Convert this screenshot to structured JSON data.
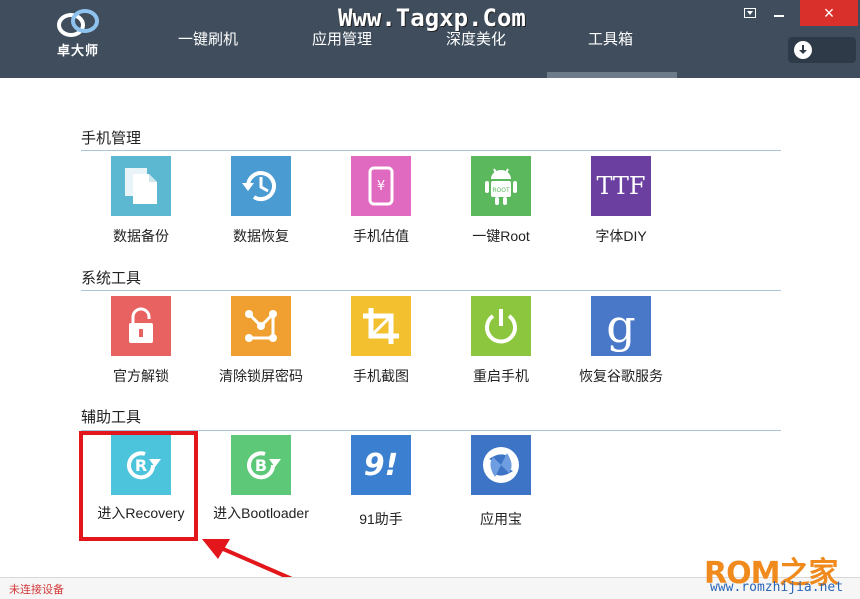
{
  "app": {
    "logo_text": "卓大师",
    "watermark": "Www.Tagxp.Com"
  },
  "nav": {
    "items": [
      {
        "label": "一键刷机"
      },
      {
        "label": "应用管理"
      },
      {
        "label": "深度美化"
      },
      {
        "label": "工具箱",
        "active": true
      }
    ]
  },
  "window_controls": {
    "close": "×"
  },
  "sections": [
    {
      "title": "手机管理",
      "tiles": [
        {
          "label": "数据备份",
          "icon": "documents-icon",
          "color": "#5bb8d0"
        },
        {
          "label": "数据恢复",
          "icon": "history-clock-icon",
          "color": "#4a9bd2"
        },
        {
          "label": "手机估值",
          "icon": "phone-yuan-icon",
          "color": "#e06ac0"
        },
        {
          "label": "一键Root",
          "icon": "android-root-icon",
          "color": "#5cb85c"
        },
        {
          "label": "字体DIY",
          "icon": "ttf-font-icon",
          "color": "#6b3fa0",
          "icon_text": "TTF"
        }
      ]
    },
    {
      "title": "系统工具",
      "tiles": [
        {
          "label": "官方解锁",
          "icon": "padlock-icon",
          "color": "#e96262"
        },
        {
          "label": "清除锁屏密码",
          "icon": "pattern-lock-icon",
          "color": "#f0a030"
        },
        {
          "label": "手机截图",
          "icon": "crop-icon",
          "color": "#f3c030"
        },
        {
          "label": "重启手机",
          "icon": "power-icon",
          "color": "#8cc63e"
        },
        {
          "label": "恢复谷歌服务",
          "icon": "google-g-icon",
          "color": "#4a78c9",
          "icon_text": "g"
        }
      ]
    },
    {
      "title": "辅助工具",
      "tiles": [
        {
          "label": "进入Recovery",
          "icon": "recovery-r-icon",
          "color": "#4cc4dc",
          "icon_text": "R"
        },
        {
          "label": "进入Bootloader",
          "icon": "bootloader-b-icon",
          "color": "#5cc878",
          "icon_text": "B"
        },
        {
          "label": "91助手",
          "icon": "ninety-one-icon",
          "color": "#3a7fd0",
          "icon_text": "9!"
        },
        {
          "label": "应用宝",
          "icon": "yingyongbao-icon",
          "color": "#3e74c5"
        }
      ]
    }
  ],
  "status": {
    "text": "未连接设备"
  },
  "brand": {
    "rom_text": "ROM之家",
    "url": "www.romzhijia.net"
  }
}
